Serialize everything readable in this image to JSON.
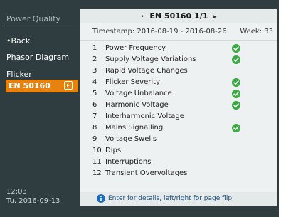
{
  "sidebar": {
    "title": "Power Quality",
    "items": [
      {
        "label": "•Back"
      },
      {
        "label": "Phasor Diagram"
      },
      {
        "label": "Flicker"
      }
    ],
    "active": {
      "label": "EN 50160",
      "arrow_icon": "arrow-right-icon"
    },
    "clock": {
      "time": "12:03",
      "date": "Tu. 2016-09-13"
    }
  },
  "header": {
    "prev": "•",
    "title": "EN 50160 1/1",
    "next": "▸"
  },
  "summary": {
    "timestamp": "Timestamp: 2016-08-19 - 2016-08-26",
    "week": "Week: 33"
  },
  "parameters": [
    {
      "num": "1",
      "label": "Power Frequency",
      "ok": true
    },
    {
      "num": "2",
      "label": "Supply Voltage Variations",
      "ok": true
    },
    {
      "num": "3",
      "label": "Rapid Voltage Changes",
      "ok": false
    },
    {
      "num": "4",
      "label": "Flicker Severity",
      "ok": true
    },
    {
      "num": "5",
      "label": "Voltage Unbalance",
      "ok": true
    },
    {
      "num": "6",
      "label": "Harmonic Voltage",
      "ok": true
    },
    {
      "num": "7",
      "label": "Interharmonic Voltage",
      "ok": false
    },
    {
      "num": "8",
      "label": "Mains Signalling",
      "ok": true
    },
    {
      "num": "9",
      "label": "Voltage Swells",
      "ok": false
    },
    {
      "num": "10",
      "label": "Dips",
      "ok": false
    },
    {
      "num": "11",
      "label": "Interruptions",
      "ok": false
    },
    {
      "num": "12",
      "label": "Transient Overvoltages",
      "ok": false
    }
  ],
  "footer": {
    "hint": "Enter for details, left/right for page flip",
    "icon": "info-icon"
  },
  "colors": {
    "accent": "#e8820e",
    "ok": "#3aa843",
    "sidebar_bg": "#2f3d41"
  }
}
